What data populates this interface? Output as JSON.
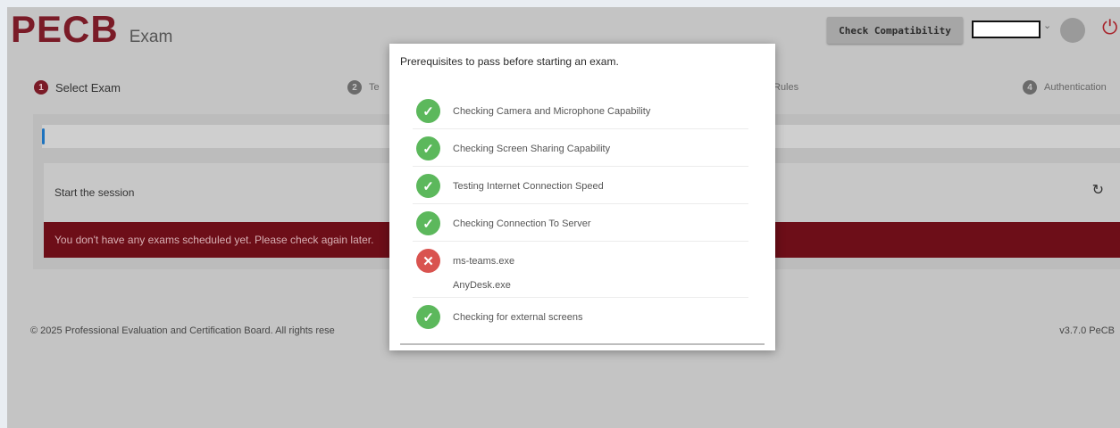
{
  "header": {
    "logo_text": "PECB",
    "logo_subtitle": "Exam",
    "check_compatibility_label": "Check Compatibility"
  },
  "steps": [
    {
      "number": "1",
      "label": "Select Exam"
    },
    {
      "number": "2",
      "label": "Te"
    },
    {
      "number": "3",
      "label": "Rules"
    },
    {
      "number": "4",
      "label": "Authentication"
    }
  ],
  "session": {
    "title": "Start the session",
    "alert": "You don't have any exams scheduled yet. Please check again later."
  },
  "footer": {
    "copyright": "© 2025 Professional Evaluation and Certification Board. All rights rese",
    "version": "v3.7.0 PeCB"
  },
  "modal": {
    "title": "Prerequisites to pass before starting an exam.",
    "items": [
      {
        "label": "Checking Camera and Microphone Capability",
        "status": "ok"
      },
      {
        "label": "Checking Screen Sharing Capability",
        "status": "ok"
      },
      {
        "label": "Testing Internet Connection Speed",
        "status": "ok"
      },
      {
        "label": "Checking Connection To Server",
        "status": "ok"
      },
      {
        "label": "ms-teams.exe",
        "sublabel": "AnyDesk.exe",
        "status": "fail"
      },
      {
        "label": "Checking for external screens",
        "status": "ok"
      }
    ]
  },
  "colors": {
    "brand": "#7a1b27",
    "alert_bg": "#6d0e18",
    "success": "#5cb85c",
    "error": "#d9534f",
    "power_icon": "#a8242c",
    "progress": "#1e73be"
  }
}
